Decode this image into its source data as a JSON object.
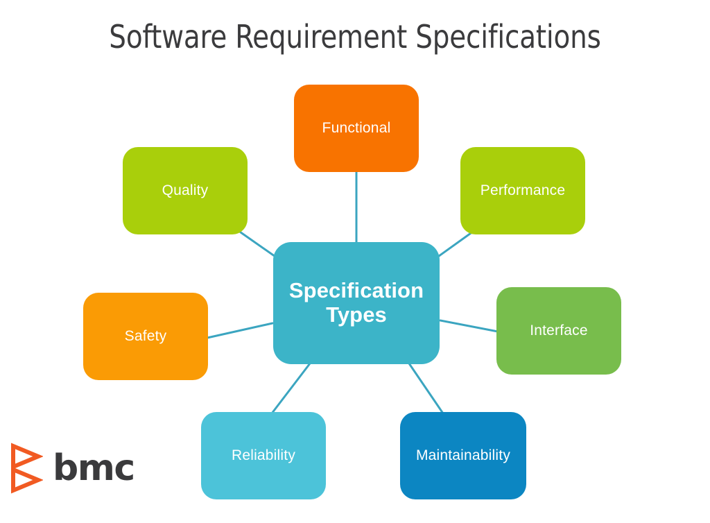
{
  "page": {
    "title": "Software Requirement Specifications",
    "background_color": "#ffffff",
    "title_color": "#3b3b3d"
  },
  "diagram": {
    "type": "hub-and-spoke mind map",
    "connector_color": "#3ba5c0",
    "center": {
      "label": "Specification Types",
      "label_line1": "Specification",
      "label_line2": "Types",
      "color": "#3cb4c8",
      "text_color": "#ffffff"
    },
    "nodes": [
      {
        "id": "functional",
        "label": "Functional",
        "color": "#f87300",
        "text_color": "#ffffff",
        "position": "top"
      },
      {
        "id": "quality",
        "label": "Quality",
        "color": "#a9cf0b",
        "text_color": "#ffffff",
        "position": "top-left"
      },
      {
        "id": "performance",
        "label": "Performance",
        "color": "#a9cf0b",
        "text_color": "#ffffff",
        "position": "top-right"
      },
      {
        "id": "safety",
        "label": "Safety",
        "color": "#fa9b05",
        "text_color": "#ffffff",
        "position": "left"
      },
      {
        "id": "interface",
        "label": "Interface",
        "color": "#78bd4c",
        "text_color": "#ffffff",
        "position": "right"
      },
      {
        "id": "reliability",
        "label": "Reliability",
        "color": "#4cc3d9",
        "text_color": "#ffffff",
        "position": "bottom-left"
      },
      {
        "id": "maintainability",
        "label": "Maintainability",
        "color": "#0c86c2",
        "text_color": "#ffffff",
        "position": "bottom-right"
      }
    ]
  },
  "logo": {
    "wordmark": "bmc",
    "mark_name": "bmc-chevron-mark",
    "mark_color": "#f15a22",
    "wordmark_color": "#3a3a3c"
  }
}
